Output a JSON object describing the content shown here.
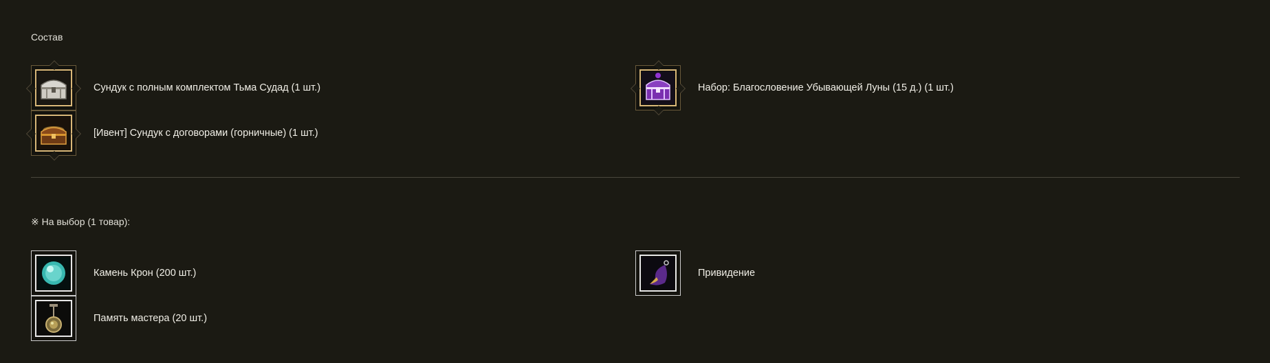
{
  "composition": {
    "title": "Состав",
    "items": [
      {
        "label": "Сундук с полным комплектом Тьма Судад (1 шт.)",
        "icon": "white-chest-icon"
      },
      {
        "label": "Набор: Благословение Убывающей Луны (15 д.) (1 шт.)",
        "icon": "purple-chest-icon"
      },
      {
        "label": "[Ивент] Сундук с договорами (горничные) (1 шт.)",
        "icon": "golden-chest-icon"
      }
    ]
  },
  "choice": {
    "title": "※ На выбор (1 товар):",
    "items": [
      {
        "label": "Камень Крон (200 шт.)",
        "icon": "crystal-orb-icon"
      },
      {
        "label": "Привидение",
        "icon": "purple-hood-icon"
      },
      {
        "label": "Память мастера (20 шт.)",
        "icon": "pendant-icon"
      }
    ]
  },
  "colors": {
    "background": "#1b1a13",
    "slot_border_gold": "#d9b778",
    "slot_border_plain": "#e8e8e8",
    "divider": "#4a483d"
  }
}
